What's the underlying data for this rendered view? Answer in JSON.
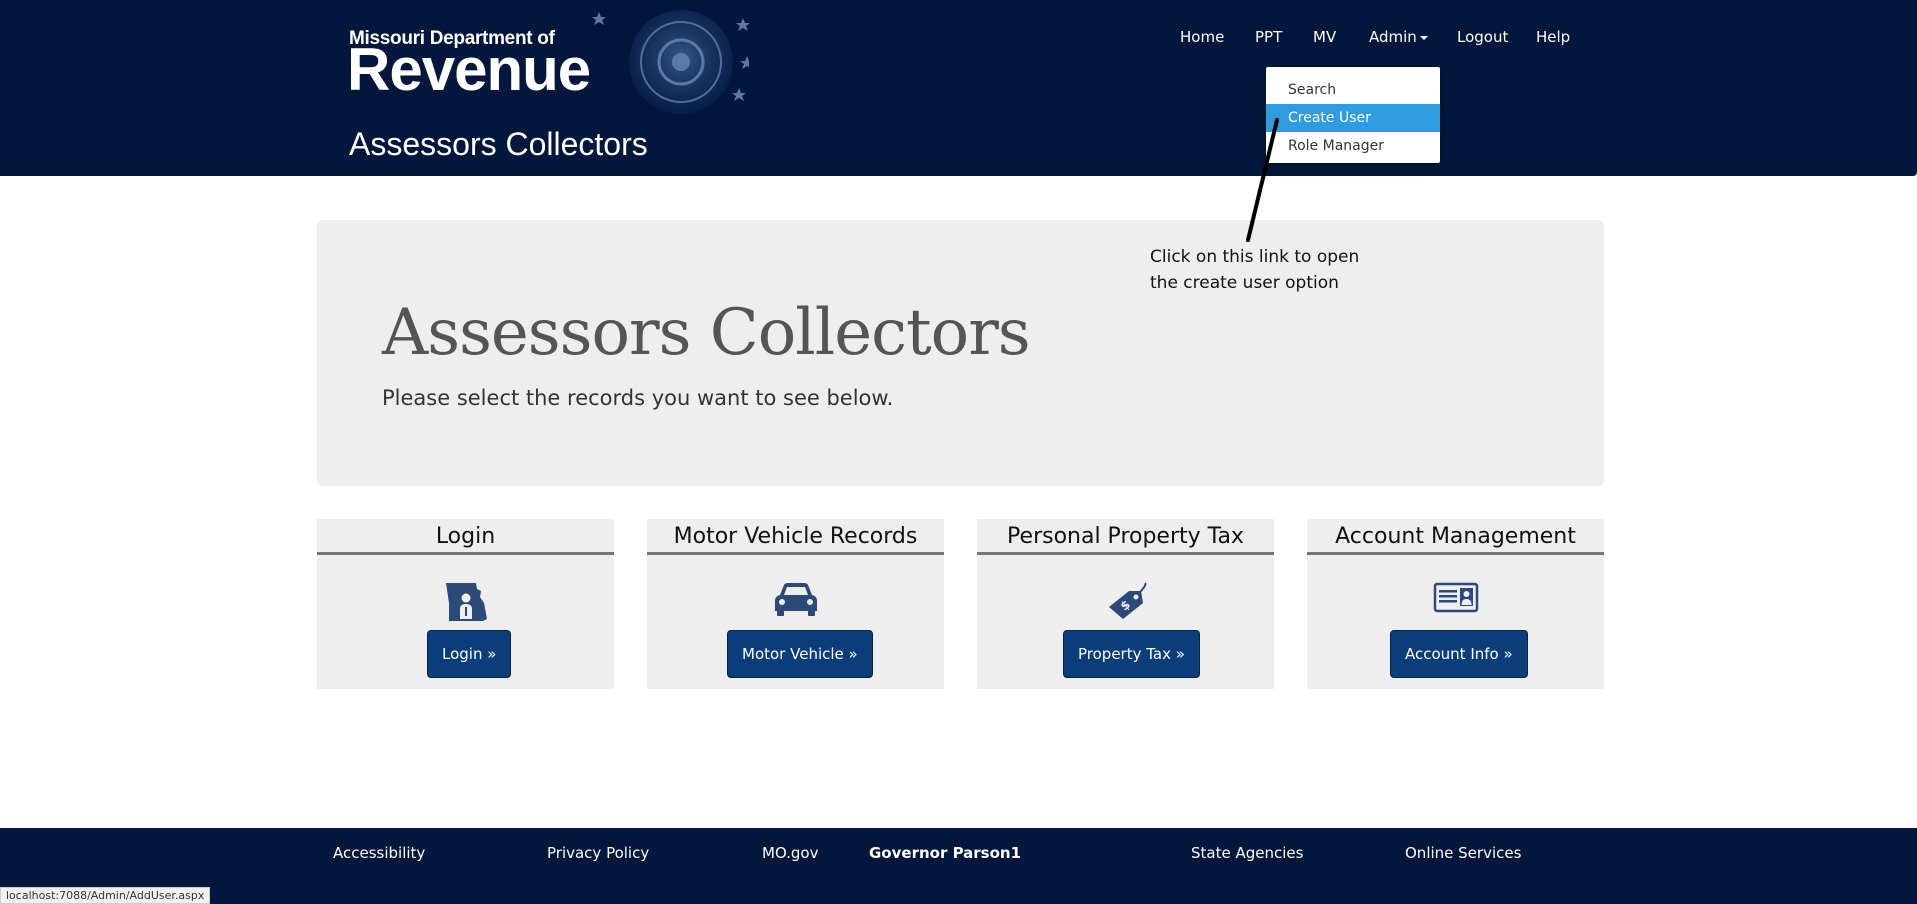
{
  "header": {
    "logo_small": "Missouri Department of",
    "logo_big": "Revenue",
    "site_title": "Assessors Collectors"
  },
  "nav": {
    "home": "Home",
    "ppt": "PPT",
    "mv": "MV",
    "admin": "Admin",
    "logout": "Logout",
    "help": "Help"
  },
  "admin_menu": {
    "items": [
      {
        "label": "Search"
      },
      {
        "label": "Create User",
        "highlighted": true
      },
      {
        "label": "Role Manager"
      }
    ]
  },
  "annotation": {
    "line1": "Click on this link to open",
    "line2": "the create user option"
  },
  "jumbotron": {
    "title": "Assessors Collectors",
    "subtitle": "Please select the records you want to see below."
  },
  "cards": [
    {
      "title": "Login",
      "icon": "missouri-person-icon",
      "button": "Login »"
    },
    {
      "title": "Motor Vehicle Records",
      "icon": "car-icon",
      "button": "Motor Vehicle »"
    },
    {
      "title": "Personal Property Tax",
      "icon": "price-tag-icon",
      "button": "Property Tax »"
    },
    {
      "title": "Account Management",
      "icon": "id-card-icon",
      "button": "Account Info »"
    }
  ],
  "footer": {
    "accessibility": "Accessibility",
    "privacy": "Privacy Policy",
    "mogov": "MO.gov",
    "governor": "Governor Parson1",
    "agencies": "State Agencies",
    "services": "Online Services"
  },
  "status_bar": {
    "url": "localhost:7088/Admin/AddUser.aspx"
  },
  "colors": {
    "header_bg": "#02173b",
    "button_bg": "#0a3d7a",
    "menu_highlight": "#2f9ce0",
    "panel_bg": "#eeeeee"
  }
}
